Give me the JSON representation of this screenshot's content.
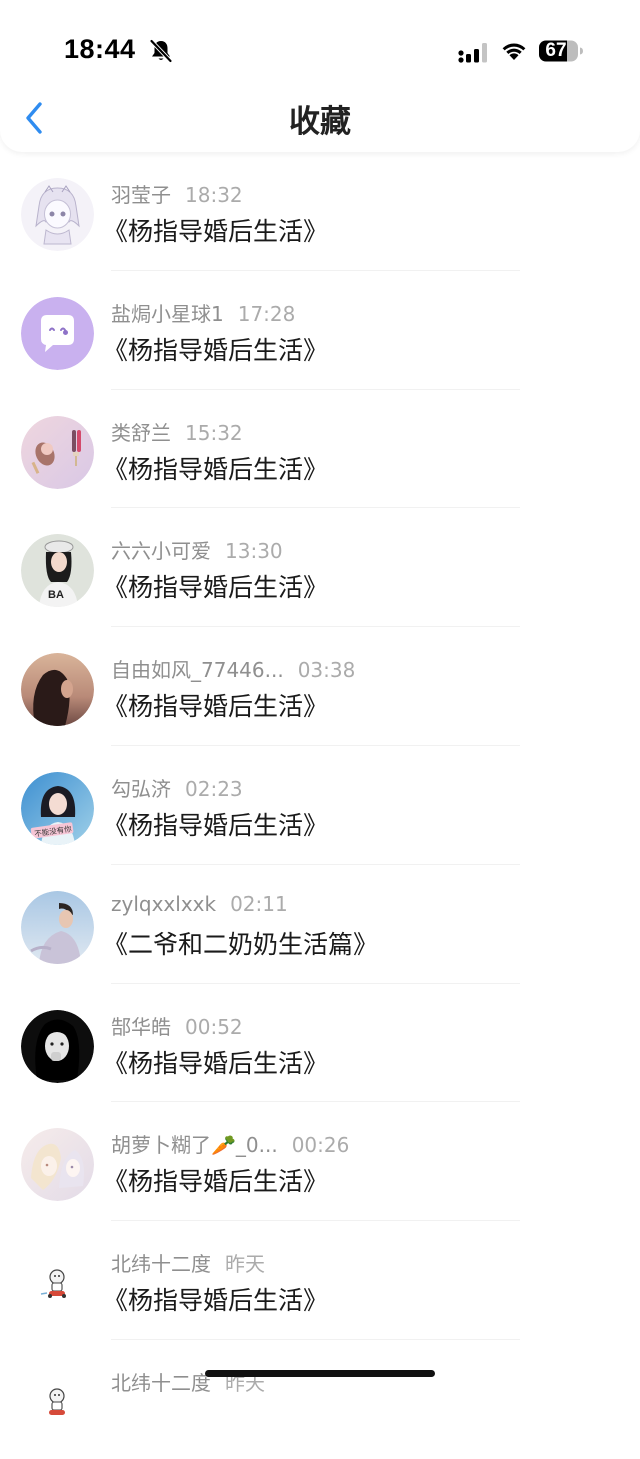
{
  "status_bar": {
    "time": "18:44",
    "battery": "67",
    "icons": [
      "bell-slash-icon",
      "cellular-signal-icon",
      "wifi-icon",
      "battery-icon"
    ]
  },
  "header": {
    "title": "收藏",
    "back_icon": "chevron-left-icon",
    "accent_color": "#2f8cf0"
  },
  "favorites": [
    {
      "user": "羽莹子",
      "time": "18:32",
      "title": "《杨指导婚后生活》",
      "avatar": "anime-sketch"
    },
    {
      "user": "盐焗小星球1",
      "time": "17:28",
      "title": "《杨指导婚后生活》",
      "avatar": "purple-chat"
    },
    {
      "user": "类舒兰",
      "time": "15:32",
      "title": "《杨指导婚后生活》",
      "avatar": "icecream"
    },
    {
      "user": "六六小可爱",
      "time": "13:30",
      "title": "《杨指导婚后生活》",
      "avatar": "girl-cap"
    },
    {
      "user": "自由如风_77446...",
      "time": "03:38",
      "title": "《杨指导婚后生活》",
      "avatar": "sunset-girl"
    },
    {
      "user": "勾弘济",
      "time": "02:23",
      "title": "《杨指导婚后生活》",
      "avatar": "girl-blue"
    },
    {
      "user": "zylqxxlxxk",
      "time": "02:11",
      "title": "《二爷和二奶奶生活篇》",
      "avatar": "guy-sky"
    },
    {
      "user": "郜华皓",
      "time": "00:52",
      "title": "《杨指导婚后生活》",
      "avatar": "bw-girl"
    },
    {
      "user": "胡萝卜糊了🥕_0...",
      "time": "00:26",
      "title": "《杨指导婚后生活》",
      "avatar": "anime-pastel"
    },
    {
      "user": "北纬十二度",
      "time": "昨天",
      "title": "《杨指导婚后生活》",
      "avatar": "mini-figure"
    },
    {
      "user": "北纬十二度",
      "time": "昨天",
      "title": "",
      "avatar": "mini-figure"
    }
  ]
}
